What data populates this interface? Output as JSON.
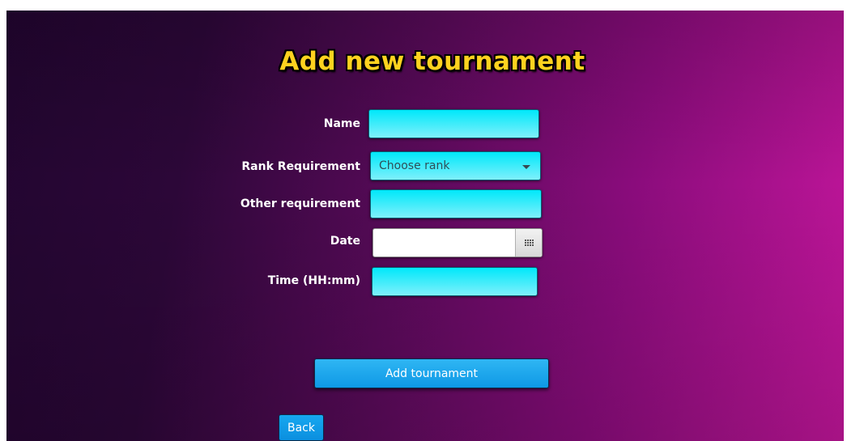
{
  "page": {
    "title": "Add new tournament"
  },
  "form": {
    "name": {
      "label": "Name",
      "value": ""
    },
    "rank": {
      "label": "Rank Requirement",
      "placeholder": "Choose rank"
    },
    "other": {
      "label": "Other requirement",
      "value": ""
    },
    "date": {
      "label": "Date",
      "value": "",
      "icon": "calendar-icon"
    },
    "time": {
      "label": "Time (HH:mm)",
      "value": ""
    }
  },
  "actions": {
    "add_label": "Add tournament",
    "back_label": "Back"
  },
  "colors": {
    "title": "#ffd21f",
    "field": "#00e8fa",
    "button": "#1aa6ee"
  }
}
